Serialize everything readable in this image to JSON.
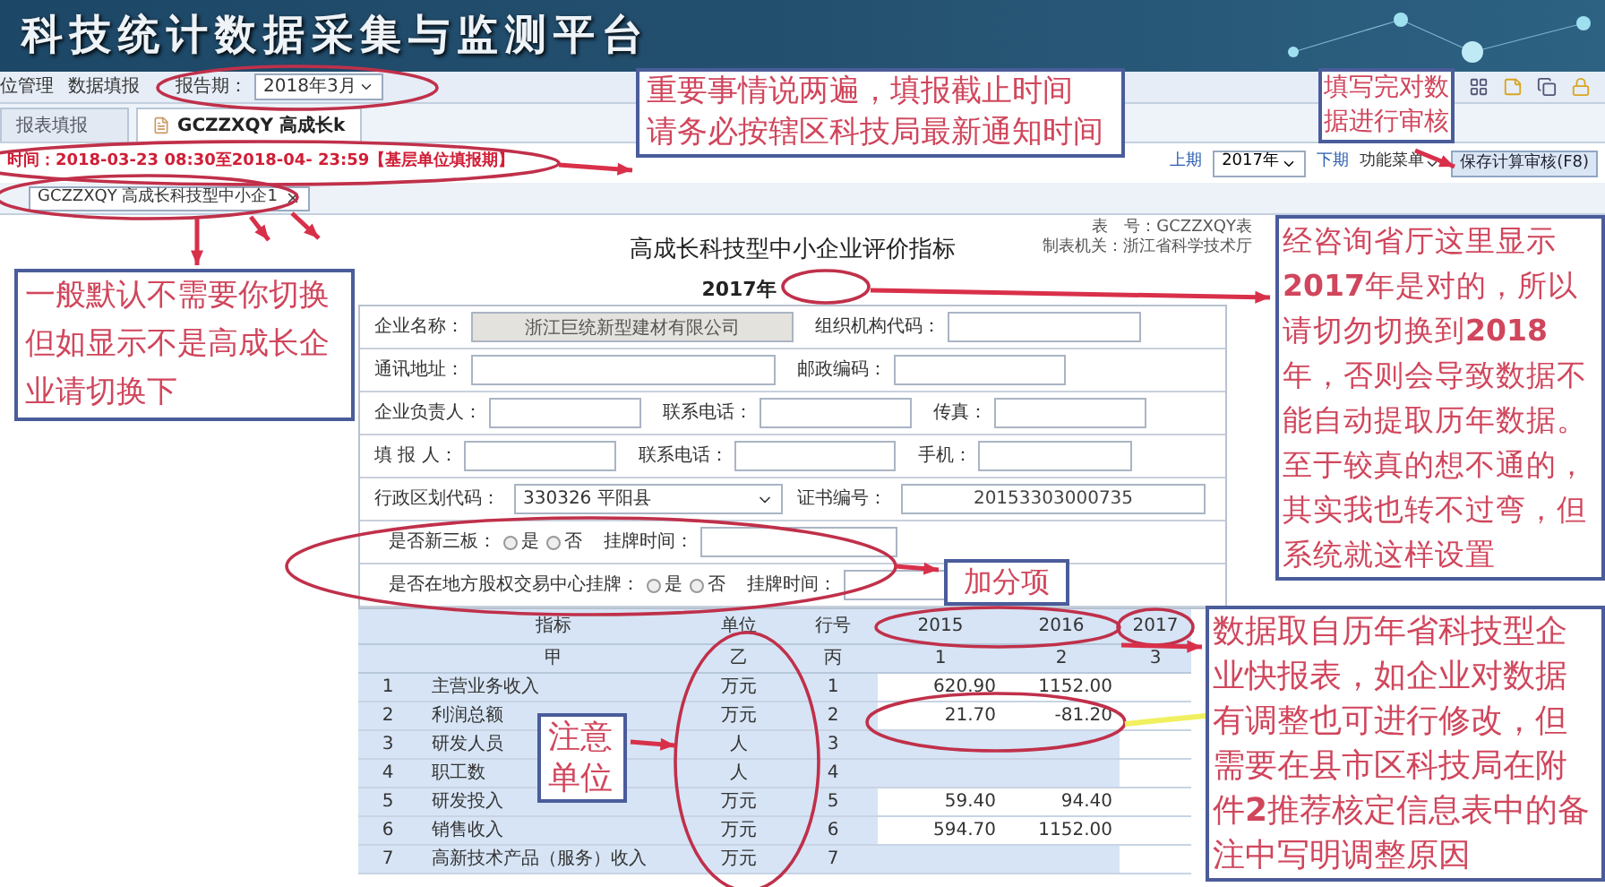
{
  "header": {
    "title": "科技统计数据采集与监测平台"
  },
  "menu": {
    "items": [
      {
        "label": "位管理"
      },
      {
        "label": "数据填报"
      }
    ],
    "period_label": "报告期：",
    "period_value": "2018年3月"
  },
  "tabs": [
    {
      "label": "报表填报",
      "selected": false
    },
    {
      "label": "GCZZXQY 高成长k",
      "selected": true
    }
  ],
  "nav": {
    "prev": "上期",
    "year": "2017年",
    "next": "下期",
    "menu": "功能菜单",
    "save": "保存计算审核(F8)"
  },
  "deadline": "时间：2018-03-23 08:30至2018-04- 23:59【基层单位填报期】",
  "report_select": "GCZZXQY 高成长科技型中小企1",
  "form": {
    "title": "高成长科技型中小企业评价指标",
    "year": "2017年",
    "meta": [
      "表　号：GCZZXQY表",
      "制表机关：浙江省科学技术厅"
    ],
    "rows": [
      {
        "kind": "fields",
        "fields": [
          {
            "label": "企业名称：",
            "value": "浙江巨统新型建材有限公司",
            "disabled": true
          },
          {
            "label": "组织机构代码：",
            "disabled": false
          }
        ]
      },
      {
        "kind": "fields",
        "fields": [
          {
            "label": "通讯地址：",
            "disabled": false
          },
          {
            "label": "邮政编码：",
            "disabled": false
          }
        ]
      },
      {
        "kind": "fields",
        "fields": [
          {
            "label": "企业负责人：",
            "disabled": false
          },
          {
            "label": "联系电话：",
            "disabled": false
          },
          {
            "label": "传真：",
            "disabled": false
          }
        ]
      },
      {
        "kind": "fields",
        "fields": [
          {
            "label": "填 报 人：",
            "disabled": false
          },
          {
            "label": "联系电话：",
            "disabled": false
          },
          {
            "label": "手机：",
            "disabled": false
          }
        ]
      },
      {
        "kind": "select",
        "label": "行政区划代码：",
        "value": "330326 平阳县",
        "label2": "证书编号：",
        "value2": "20153303000735"
      },
      {
        "kind": "radio",
        "label": "是否新三板：",
        "options": [
          {
            "label": "是",
            "selected": false
          },
          {
            "label": "否",
            "selected": false
          }
        ],
        "time_label": "挂牌时间："
      },
      {
        "kind": "radio",
        "label": "是否在地方股权交易中心挂牌：",
        "options": [
          {
            "label": "是",
            "selected": false
          },
          {
            "label": "否",
            "selected": false
          }
        ],
        "time_label": "挂牌时间："
      }
    ]
  },
  "table": {
    "columns": [
      "指标",
      "单位",
      "行号",
      "2015",
      "2016",
      "2017"
    ],
    "subheader": [
      "甲",
      "乙",
      "丙",
      "1",
      "2",
      "3"
    ],
    "rows": [
      {
        "no": "1",
        "name": "主营业务收入",
        "unit": "万元",
        "line": "1",
        "y2015": "620.90",
        "y2016": "1152.00"
      },
      {
        "no": "2",
        "name": "利润总额",
        "unit": "万元",
        "line": "2",
        "y2015": "21.70",
        "y2016": "-81.20"
      },
      {
        "no": "3",
        "name": "研发人员",
        "unit": "人",
        "line": "3"
      },
      {
        "no": "4",
        "name": "职工数",
        "unit": "人",
        "line": "4"
      },
      {
        "no": "5",
        "name": "研发投入",
        "unit": "万元",
        "line": "5",
        "y2015": "59.40",
        "y2016": "94.40"
      },
      {
        "no": "6",
        "name": "销售收入",
        "unit": "万元",
        "line": "6",
        "y2015": "594.70",
        "y2016": "1152.00"
      },
      {
        "no": "7",
        "name": "高新技术产品（服务）收入",
        "unit": "万元",
        "line": "7"
      }
    ]
  },
  "annotations": {
    "deadline_note": [
      "重要事情说两遍，填报截止时间",
      "请务必按辖区科技局最新通知时间"
    ],
    "review_note": "填写完对数据进行审核",
    "switch_note": "一般默认不需要你切换但如显示不是高成长企业请切换下",
    "year_note": "经咨询省厅这里显示**2017**年是对的，所以请切勿切换到**2018**年，否则会导致数据不能自动提取历年数据。至于较真的想不通的，其实我也转不过弯，但系统就这样设置",
    "bonus_note": "加分项",
    "unit_note": "注意单位",
    "history_note": "数据取自历年省科技型企业快报表，如企业对数据有调整也可进行修改，但需要在县市区科技局在附件**2**推荐核定信息表中的备注中写明调整原因"
  }
}
